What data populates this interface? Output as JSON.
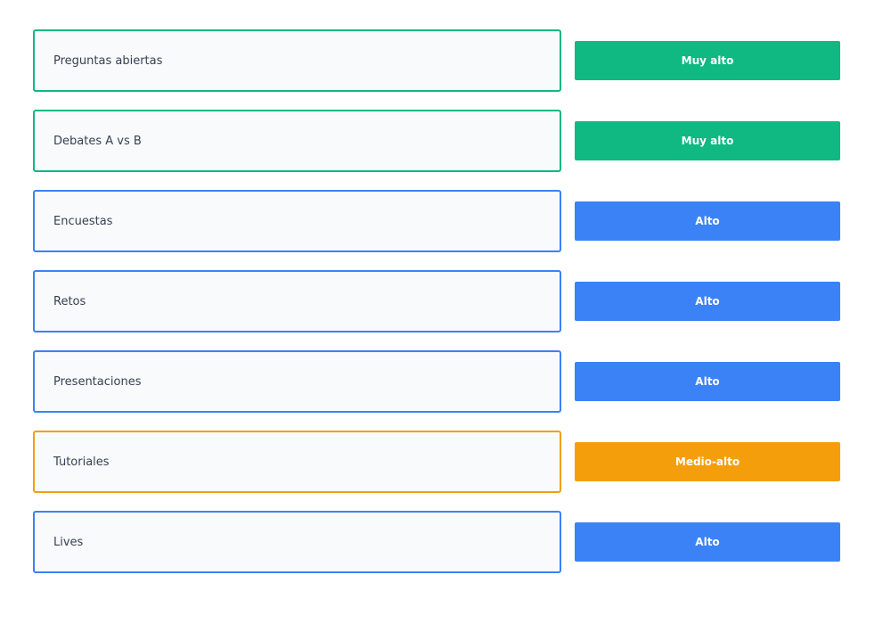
{
  "colors": {
    "muy_alto": "#10b981",
    "alto": "#3b82f6",
    "medio_alto": "#f59e0b",
    "card_background": "#f8fafc",
    "label_text": "#374151"
  },
  "rows": [
    {
      "label": "Preguntas abiertas",
      "level": "Muy alto"
    },
    {
      "label": "Debates A vs B",
      "level": "Muy alto"
    },
    {
      "label": "Encuestas",
      "level": "Alto"
    },
    {
      "label": "Retos",
      "level": "Alto"
    },
    {
      "label": "Presentaciones",
      "level": "Alto"
    },
    {
      "label": "Tutoriales",
      "level": "Medio-alto"
    },
    {
      "label": "Lives",
      "level": "Alto"
    }
  ]
}
